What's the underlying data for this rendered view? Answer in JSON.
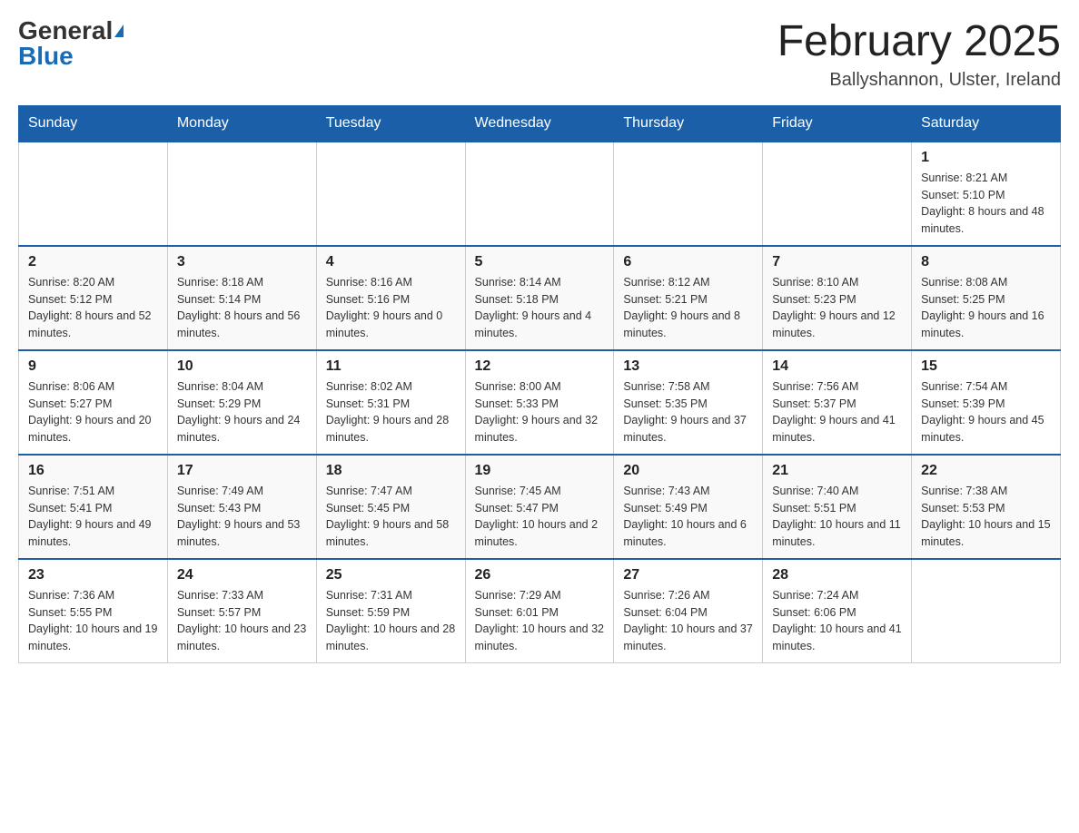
{
  "header": {
    "logo_general": "General",
    "logo_blue": "Blue",
    "month_title": "February 2025",
    "location": "Ballyshannon, Ulster, Ireland"
  },
  "days_of_week": [
    "Sunday",
    "Monday",
    "Tuesday",
    "Wednesday",
    "Thursday",
    "Friday",
    "Saturday"
  ],
  "weeks": [
    [
      {
        "day": "",
        "info": ""
      },
      {
        "day": "",
        "info": ""
      },
      {
        "day": "",
        "info": ""
      },
      {
        "day": "",
        "info": ""
      },
      {
        "day": "",
        "info": ""
      },
      {
        "day": "",
        "info": ""
      },
      {
        "day": "1",
        "info": "Sunrise: 8:21 AM\nSunset: 5:10 PM\nDaylight: 8 hours and 48 minutes."
      }
    ],
    [
      {
        "day": "2",
        "info": "Sunrise: 8:20 AM\nSunset: 5:12 PM\nDaylight: 8 hours and 52 minutes."
      },
      {
        "day": "3",
        "info": "Sunrise: 8:18 AM\nSunset: 5:14 PM\nDaylight: 8 hours and 56 minutes."
      },
      {
        "day": "4",
        "info": "Sunrise: 8:16 AM\nSunset: 5:16 PM\nDaylight: 9 hours and 0 minutes."
      },
      {
        "day": "5",
        "info": "Sunrise: 8:14 AM\nSunset: 5:18 PM\nDaylight: 9 hours and 4 minutes."
      },
      {
        "day": "6",
        "info": "Sunrise: 8:12 AM\nSunset: 5:21 PM\nDaylight: 9 hours and 8 minutes."
      },
      {
        "day": "7",
        "info": "Sunrise: 8:10 AM\nSunset: 5:23 PM\nDaylight: 9 hours and 12 minutes."
      },
      {
        "day": "8",
        "info": "Sunrise: 8:08 AM\nSunset: 5:25 PM\nDaylight: 9 hours and 16 minutes."
      }
    ],
    [
      {
        "day": "9",
        "info": "Sunrise: 8:06 AM\nSunset: 5:27 PM\nDaylight: 9 hours and 20 minutes."
      },
      {
        "day": "10",
        "info": "Sunrise: 8:04 AM\nSunset: 5:29 PM\nDaylight: 9 hours and 24 minutes."
      },
      {
        "day": "11",
        "info": "Sunrise: 8:02 AM\nSunset: 5:31 PM\nDaylight: 9 hours and 28 minutes."
      },
      {
        "day": "12",
        "info": "Sunrise: 8:00 AM\nSunset: 5:33 PM\nDaylight: 9 hours and 32 minutes."
      },
      {
        "day": "13",
        "info": "Sunrise: 7:58 AM\nSunset: 5:35 PM\nDaylight: 9 hours and 37 minutes."
      },
      {
        "day": "14",
        "info": "Sunrise: 7:56 AM\nSunset: 5:37 PM\nDaylight: 9 hours and 41 minutes."
      },
      {
        "day": "15",
        "info": "Sunrise: 7:54 AM\nSunset: 5:39 PM\nDaylight: 9 hours and 45 minutes."
      }
    ],
    [
      {
        "day": "16",
        "info": "Sunrise: 7:51 AM\nSunset: 5:41 PM\nDaylight: 9 hours and 49 minutes."
      },
      {
        "day": "17",
        "info": "Sunrise: 7:49 AM\nSunset: 5:43 PM\nDaylight: 9 hours and 53 minutes."
      },
      {
        "day": "18",
        "info": "Sunrise: 7:47 AM\nSunset: 5:45 PM\nDaylight: 9 hours and 58 minutes."
      },
      {
        "day": "19",
        "info": "Sunrise: 7:45 AM\nSunset: 5:47 PM\nDaylight: 10 hours and 2 minutes."
      },
      {
        "day": "20",
        "info": "Sunrise: 7:43 AM\nSunset: 5:49 PM\nDaylight: 10 hours and 6 minutes."
      },
      {
        "day": "21",
        "info": "Sunrise: 7:40 AM\nSunset: 5:51 PM\nDaylight: 10 hours and 11 minutes."
      },
      {
        "day": "22",
        "info": "Sunrise: 7:38 AM\nSunset: 5:53 PM\nDaylight: 10 hours and 15 minutes."
      }
    ],
    [
      {
        "day": "23",
        "info": "Sunrise: 7:36 AM\nSunset: 5:55 PM\nDaylight: 10 hours and 19 minutes."
      },
      {
        "day": "24",
        "info": "Sunrise: 7:33 AM\nSunset: 5:57 PM\nDaylight: 10 hours and 23 minutes."
      },
      {
        "day": "25",
        "info": "Sunrise: 7:31 AM\nSunset: 5:59 PM\nDaylight: 10 hours and 28 minutes."
      },
      {
        "day": "26",
        "info": "Sunrise: 7:29 AM\nSunset: 6:01 PM\nDaylight: 10 hours and 32 minutes."
      },
      {
        "day": "27",
        "info": "Sunrise: 7:26 AM\nSunset: 6:04 PM\nDaylight: 10 hours and 37 minutes."
      },
      {
        "day": "28",
        "info": "Sunrise: 7:24 AM\nSunset: 6:06 PM\nDaylight: 10 hours and 41 minutes."
      },
      {
        "day": "",
        "info": ""
      }
    ]
  ]
}
